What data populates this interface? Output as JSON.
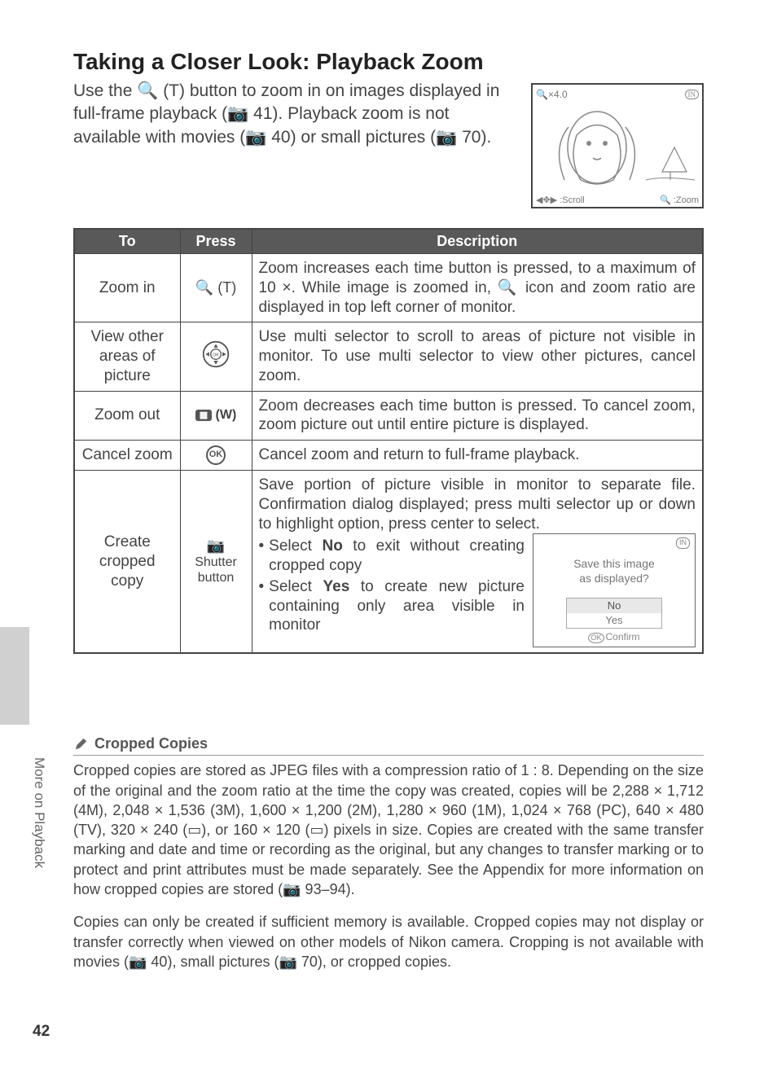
{
  "h1": "Taking a Closer Look: Playback Zoom",
  "intro": "Use the 🔍 (T) button to zoom in on images displayed in full-frame playback (📷 41). Playback zoom is not available with movies (📷 40) or small pictures (📷 70).",
  "preview": {
    "zfactor": "🔍×4.0",
    "in": "IN",
    "scroll": "◀✥▶ :Scroll",
    "zoom": "🔍 :Zoom"
  },
  "table": {
    "h1": "To",
    "h2": "Press",
    "h3": "Description",
    "rows": [
      {
        "to": "Zoom in",
        "press": "🔍 (T)",
        "desc": "Zoom increases each time button is pressed, to a maximum of 10 ×.  While image is zoomed in, 🔍 icon and zoom ratio are displayed in top left corner of monitor."
      },
      {
        "to": "View other areas of picture",
        "press": "selector",
        "desc": "Use multi selector to scroll to areas of picture not visible in monitor.  To use multi selector to view other pictures, cancel zoom."
      },
      {
        "to": "Zoom out",
        "press": "▣ (W)",
        "desc": "Zoom decreases each time button is pressed.  To cancel zoom, zoom picture out until entire picture is displayed."
      },
      {
        "to": "Cancel zoom",
        "press": "OK",
        "desc": "Cancel zoom and return to full-frame playback."
      },
      {
        "to": "Create cropped copy",
        "press_l1": "Shutter",
        "press_l2": "button",
        "desc_top": "Save portion of picture visible in monitor to separate file.  Confirmation dialog displayed; press multi selector up or down to highlight option, press center to select.",
        "b1a": "Select ",
        "b1b": "No",
        "b1c": " to exit without creating cropped copy",
        "b2a": "Select ",
        "b2b": "Yes",
        "b2c": " to create new picture containing only area visible in monitor"
      }
    ]
  },
  "crop_dialog": {
    "in": "IN",
    "line1": "Save this image",
    "line2": "as displayed?",
    "no": "No",
    "yes": "Yes",
    "ok": "OK",
    "confirm": "Confirm"
  },
  "section2": {
    "title": "Cropped Copies",
    "p1": "Cropped copies are stored as JPEG files with a compression ratio of 1 : 8.  Depending on the size of the original and the zoom ratio at the time the copy was created, copies will be 2,288 × 1,712 (4M), 2,048 × 1,536 (3M), 1,600 × 1,200 (2M), 1,280 × 960 (1M), 1,024 × 768 (PC), 640 × 480 (TV), 320 × 240 (▭), or 160 × 120 (▭) pixels in size.  Copies are created with the same transfer marking and date and time or recording as the original, but any changes to transfer marking or to protect and print attributes must be made separately.  See the Appendix for more information on how cropped copies are stored (📷 93–94).",
    "p2": "Copies can only be created if sufficient memory is available.  Cropped copies may not display or transfer correctly when viewed on other models of Nikon camera.  Cropping is not available with movies (📷 40), small pictures (📷 70), or cropped copies."
  },
  "side_label": "More on Playback",
  "page_num": "42"
}
